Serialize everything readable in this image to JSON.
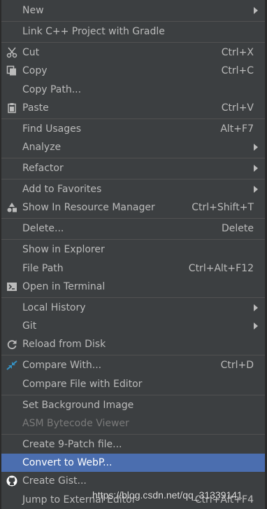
{
  "menu": {
    "items": [
      {
        "label": "New",
        "shortcut": "",
        "submenu": true
      },
      {
        "label": "Link C++ Project with Gradle",
        "shortcut": ""
      },
      {
        "label": "Cut",
        "shortcut": "Ctrl+X",
        "icon": "scissors-icon"
      },
      {
        "label": "Copy",
        "shortcut": "Ctrl+C",
        "icon": "copy-icon"
      },
      {
        "label": "Copy Path...",
        "shortcut": ""
      },
      {
        "label": "Paste",
        "shortcut": "Ctrl+V",
        "icon": "clipboard-icon"
      },
      {
        "label": "Find Usages",
        "shortcut": "Alt+F7"
      },
      {
        "label": "Analyze",
        "shortcut": "",
        "submenu": true
      },
      {
        "label": "Refactor",
        "shortcut": "",
        "submenu": true
      },
      {
        "label": "Add to Favorites",
        "shortcut": "",
        "submenu": true
      },
      {
        "label": "Show In Resource Manager",
        "shortcut": "Ctrl+Shift+T",
        "icon": "resource-manager-icon"
      },
      {
        "label": "Delete...",
        "shortcut": "Delete"
      },
      {
        "label": "Show in Explorer",
        "shortcut": ""
      },
      {
        "label": "File Path",
        "shortcut": "Ctrl+Alt+F12"
      },
      {
        "label": "Open in Terminal",
        "shortcut": "",
        "icon": "terminal-icon"
      },
      {
        "label": "Local History",
        "shortcut": "",
        "submenu": true
      },
      {
        "label": "Git",
        "shortcut": "",
        "submenu": true
      },
      {
        "label": "Reload from Disk",
        "shortcut": "",
        "icon": "reload-icon"
      },
      {
        "label": "Compare With...",
        "shortcut": "Ctrl+D",
        "icon": "compare-icon"
      },
      {
        "label": "Compare File with Editor",
        "shortcut": ""
      },
      {
        "label": "Set Background Image",
        "shortcut": ""
      },
      {
        "label": "ASM Bytecode Viewer",
        "shortcut": "",
        "disabled": true
      },
      {
        "label": "Create 9-Patch file...",
        "shortcut": ""
      },
      {
        "label": "Convert to WebP...",
        "shortcut": "",
        "selected": true
      },
      {
        "label": "Create Gist...",
        "shortcut": "",
        "icon": "github-icon"
      },
      {
        "label": "Jump to External Editor",
        "shortcut": "Ctrl+Alt+F4"
      }
    ]
  },
  "watermark": "https://blog.csdn.net/qq_31339141",
  "colors": {
    "background": "#3c3f41",
    "selected": "#4b6eaf",
    "text": "#bbbbbb",
    "disabled": "#7a7a7a"
  }
}
